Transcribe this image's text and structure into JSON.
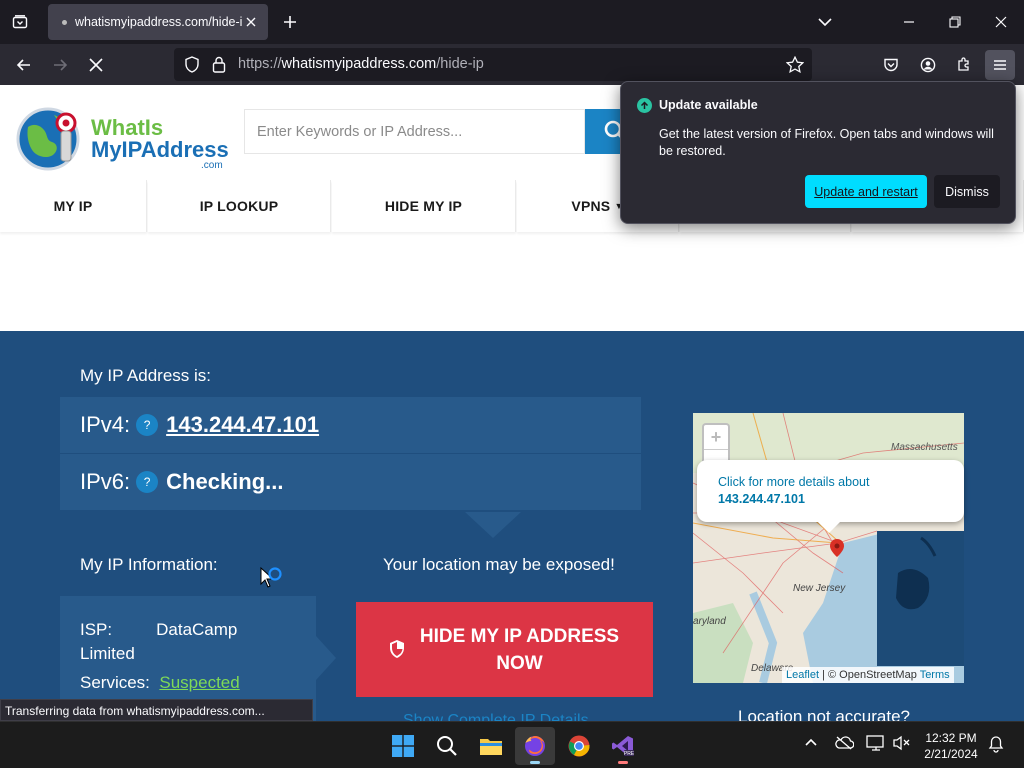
{
  "browser": {
    "tab_title": "whatismyipaddress.com/hide-ip",
    "url_prefix": "https://",
    "url_domain": "whatismyipaddress.com",
    "url_path": "/hide-ip"
  },
  "site": {
    "logo_line1": "WhatIs",
    "logo_line2": "MyIPAddress",
    "logo_line3": ".com",
    "search_placeholder": "Enter Keywords or IP Address...",
    "nav": [
      {
        "label": "MY IP"
      },
      {
        "label": "IP LOOKUP"
      },
      {
        "label": "HIDE MY IP"
      },
      {
        "label": "VPNS"
      }
    ],
    "my_ip_heading": "My IP Address is:",
    "ipv4_label": "IPv4:",
    "ipv4_value": "143.244.47.101",
    "ipv6_label": "IPv6:",
    "ipv6_value": "Checking...",
    "qmark": "?",
    "info_heading": "My IP Information:",
    "isp_label": "ISP:",
    "isp_value": "DataCamp",
    "isp_value2": "Limited",
    "services_label": "Services:",
    "services_value": "Suspected",
    "exposed_text": "Your location may be exposed!",
    "hide_button_line1": "HIDE MY IP ADDRESS",
    "hide_button_line2": "NOW",
    "map_popup_line1": "Click for more details about",
    "map_popup_ip": "143.244.47.101",
    "map_labels": {
      "ma": "Massachusetts",
      "nj": "New Jersey",
      "md": "aryland",
      "de": "Delaware"
    },
    "attribution_leaflet": "Leaflet",
    "attribution_osm": "| © OpenStreetMap",
    "attribution_terms": "Terms",
    "location_question": "Location not accurate?",
    "partial_link": "Show Complete IP Details"
  },
  "status_text": "Transferring data from whatismyipaddress.com...",
  "update_panel": {
    "title": "Update available",
    "body": "Get the latest version of Firefox. Open tabs and windows will be restored.",
    "primary": "Update and restart",
    "secondary": "Dismiss"
  },
  "taskbar": {
    "time": "12:32 PM",
    "date": "2/21/2024"
  },
  "colors": {
    "blue_section": "#1f4e7e",
    "ip_row": "#285a8b",
    "hide_button": "#dc3545",
    "accent_cyan": "#00ddff",
    "suspected_green": "#7ed957"
  }
}
